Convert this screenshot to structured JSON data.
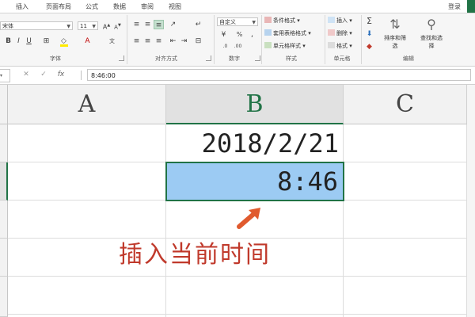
{
  "ribbon_tabs": [
    "插入",
    "页面布局",
    "公式",
    "数据",
    "审阅",
    "视图"
  ],
  "login_label": "登录",
  "font": {
    "name": "宋体",
    "size": "11"
  },
  "number_format": "自定义",
  "styles_items": [
    "条件格式",
    "套用表格格式",
    "单元格样式"
  ],
  "cells_items": [
    "插入",
    "删除",
    "格式"
  ],
  "editing_items": [
    "排序和筛选",
    "查找和选择"
  ],
  "group_labels": {
    "font": "字体",
    "alignment": "对齐方式",
    "number": "数字",
    "styles": "样式",
    "cells": "单元格",
    "editing": "编辑"
  },
  "formula_bar": {
    "value": "8:46:00",
    "fx": "fx"
  },
  "columns": [
    "A",
    "B",
    "C"
  ],
  "active_column": "B",
  "cells": {
    "b1": "2018/2/21",
    "b2": "8:46"
  },
  "annotation": "插入当前时间",
  "colors": {
    "accent": "#217346",
    "selection": "#9ccbf3",
    "annotation": "#c0392b"
  }
}
